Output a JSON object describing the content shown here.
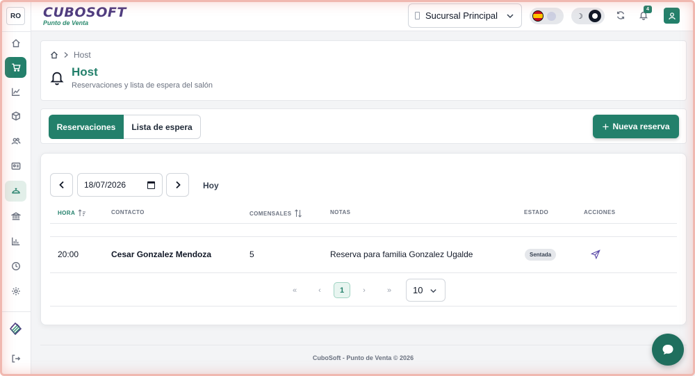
{
  "sidebar": {
    "user_initials": "RO",
    "items": [
      {
        "name": "home-icon"
      },
      {
        "name": "cart-icon",
        "active": true
      },
      {
        "name": "chart-line-icon"
      },
      {
        "name": "box-icon"
      },
      {
        "name": "users-icon"
      },
      {
        "name": "id-card-icon"
      },
      {
        "name": "host-icon",
        "hover": true
      },
      {
        "name": "bank-icon"
      },
      {
        "name": "bar-chart-icon"
      },
      {
        "name": "clock-icon"
      },
      {
        "name": "gear-icon"
      }
    ]
  },
  "header": {
    "logo_main": "CUBOSOFT",
    "logo_sub": "Punto de Venta",
    "branch": "Sucursal Principal",
    "notifications_count": "4"
  },
  "breadcrumb": {
    "current": "Host"
  },
  "page": {
    "title": "Host",
    "subtitle": "Reservaciones y lista de espera del salón"
  },
  "tabs": {
    "reservations": "Reservaciones",
    "waitlist": "Lista de espera"
  },
  "new_reservation_label": "Nueva reserva",
  "date_filter": {
    "value": "18/07/2026",
    "today_label": "Hoy"
  },
  "table": {
    "headers": {
      "hora": "HORA",
      "contacto": "CONTACTO",
      "comensales": "COMENSALES",
      "notas": "NOTAS",
      "estado": "ESTADO",
      "acciones": "ACCIONES"
    },
    "rows": [
      {
        "hora": "20:00",
        "contacto": "Cesar Gonzalez Mendoza",
        "comensales": "5",
        "notas": "Reserva para familia Gonzalez Ugalde",
        "estado": "Sentada"
      }
    ]
  },
  "pagination": {
    "current_page": "1",
    "page_size": "10"
  },
  "footer": "CuboSoft - Punto de Venta © 2026",
  "colors": {
    "primary": "#23806b",
    "brand_purple": "#4f3d80"
  }
}
